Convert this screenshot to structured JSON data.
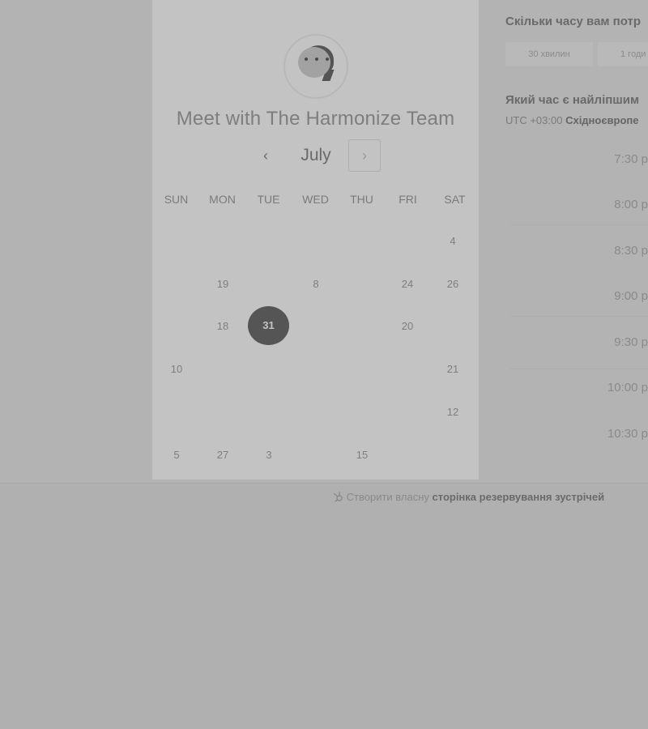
{
  "calendar": {
    "title": "Meet with The Harmonize Team",
    "month": "July",
    "prev_icon": "‹",
    "next_icon": "›",
    "weekdays": [
      "SUN",
      "MON",
      "TUE",
      "WED",
      "THU",
      "FRI",
      "SAT"
    ],
    "days": {
      "d4": "4",
      "d19": "19",
      "d8": "8",
      "d24": "24",
      "d26": "26",
      "d18": "18",
      "d31": "31",
      "d20": "20",
      "d10": "10",
      "d21": "21",
      "d12": "12",
      "d5": "5",
      "d27": "27",
      "d3": "3",
      "d15": "15"
    }
  },
  "duration": {
    "question": "Скільки часу вам потр",
    "options": [
      "30 хвилин",
      "1 годи"
    ]
  },
  "time": {
    "question": "Який час є найліпшим",
    "tz_offset": "UTC +03:00",
    "tz_name": "Східноєвропе",
    "slots": [
      "7:30 p",
      "8:00 p",
      "8:30 p",
      "9:00 p",
      "9:30 p",
      "10:00 p",
      "10:30 p"
    ]
  },
  "footer": {
    "prefix": "Створити власну",
    "link": "сторінка резервування зустрічей"
  }
}
